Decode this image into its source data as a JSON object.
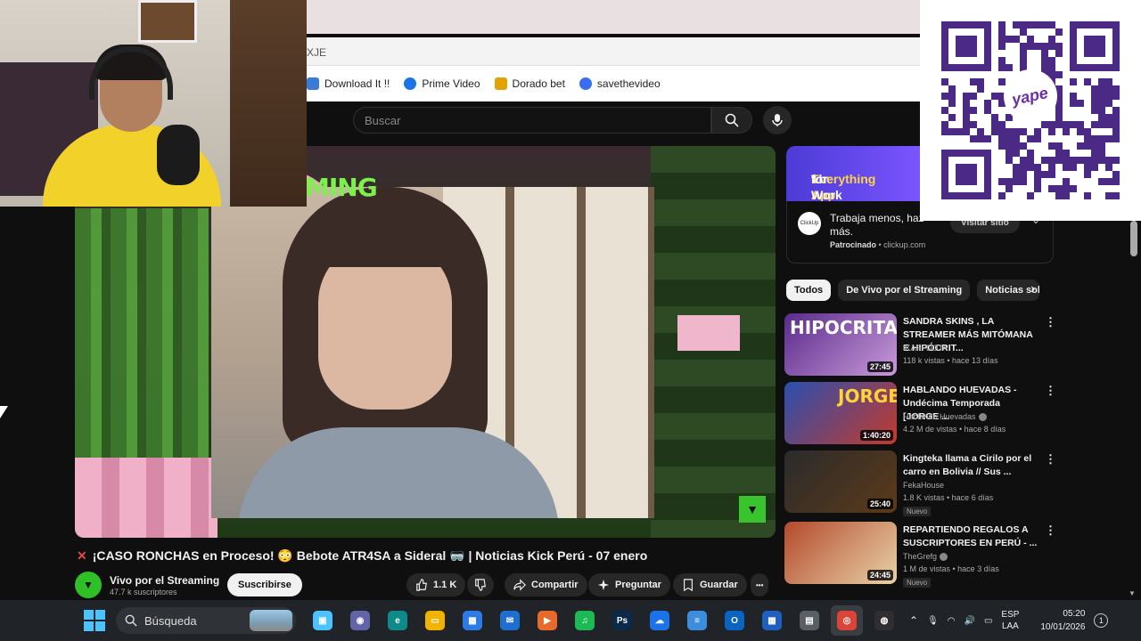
{
  "browser": {
    "url_fragment": "XJE",
    "bookmarks": [
      {
        "label": "Download It !!",
        "color": "#3b7bd6"
      },
      {
        "label": "Prime Video",
        "color": "#1a73e8"
      },
      {
        "label": "Dorado bet",
        "color": "#e2a200"
      },
      {
        "label": "savethevideo",
        "color": "#3a6df0"
      }
    ]
  },
  "youtube": {
    "search_placeholder": "Buscar",
    "video": {
      "overlay_text": "MING",
      "title_mark": "✕",
      "title": "¡CASO RONCHAS en Proceso! 😳 Bebote ATR4SA a Sideral 🥽 | Noticias Kick Perú - 07 enero",
      "channel_name": "Vivo por el Streaming",
      "channel_subs": "47.7 k suscriptores",
      "subscribe_label": "Suscribirse",
      "like_count": "1.1 K",
      "share_label": "Compartir",
      "ask_label": "Preguntar",
      "save_label": "Guardar",
      "more_label": "•••"
    },
    "ad": {
      "banner_line1_prefix": "The",
      "banner_line1_highlight": "Everything App",
      "banner_line2": "for Work",
      "logo_label": "ClickUp",
      "text": "Trabaja menos, haz más.",
      "sponsored_label": "Patrocinado",
      "domain": "clickup.com",
      "visit_label": "Visitar sitio"
    },
    "chips": [
      "Todos",
      "De Vivo por el Streaming",
      "Noticias sob"
    ],
    "recommendations": [
      {
        "thumb_text": "HIPOCRITA",
        "duration": "27:45",
        "title": "SANDRA SKINS , LA STREAMER MÁS MITÓMANA E HIPÓCRIT...",
        "channel": "IKARI DOTA",
        "meta": "118 k vistas • hace 13 días",
        "badge": "",
        "thumb_color": "#5a2b8c"
      },
      {
        "thumb_text": "JORGE",
        "duration": "1:40:20",
        "title": "HABLANDO HUEVADAS - Undécima Temporada [JORGE ...",
        "channel": "Hablando Huevadas",
        "meta": "4.2 M de vistas • hace 8 días",
        "badge": "",
        "thumb_color": "#2a4fb0"
      },
      {
        "thumb_text": "",
        "duration": "25:40",
        "title": "Kingteka llama a Cirilo por el carro en Bolivia // Sus ...",
        "channel": "FekaHouse",
        "meta": "1.8 K vistas • hace 6 días",
        "badge": "Nuevo",
        "thumb_color": "#3a3a3a"
      },
      {
        "thumb_text": "",
        "duration": "24:45",
        "title": "REPARTIENDO REGALOS A SUSCRIPTORES EN PERÚ - ...",
        "channel": "TheGrefg",
        "meta": "1 M de vistas • hace 3 días",
        "badge": "Nuevo",
        "thumb_color": "#9a3a2c"
      }
    ]
  },
  "qr": {
    "brand": "yape"
  },
  "taskbar": {
    "search_label": "Búsqueda",
    "lang_line1": "ESP",
    "lang_line2": "LAA",
    "time": "05:20",
    "date": "10/01/2026",
    "notif_count": "1",
    "apps": [
      {
        "name": "task-view",
        "color": "#4cc2ff",
        "glyph": "▣"
      },
      {
        "name": "teams",
        "color": "#6264a7",
        "glyph": "◉"
      },
      {
        "name": "edge",
        "color": "#0f8a8a",
        "glyph": "e"
      },
      {
        "name": "file-explorer",
        "color": "#f2b300",
        "glyph": "▭"
      },
      {
        "name": "store",
        "color": "#2c7be5",
        "glyph": "▦"
      },
      {
        "name": "mail",
        "color": "#1f6fd1",
        "glyph": "✉"
      },
      {
        "name": "media-player",
        "color": "#e86a2a",
        "glyph": "▶"
      },
      {
        "name": "spotify",
        "color": "#1db954",
        "glyph": "♫"
      },
      {
        "name": "photoshop",
        "color": "#0b2a4a",
        "glyph": "Ps"
      },
      {
        "name": "onedrive",
        "color": "#1a73e8",
        "glyph": "☁"
      },
      {
        "name": "notepad",
        "color": "#3c8dde",
        "glyph": "≡"
      },
      {
        "name": "outlook",
        "color": "#0a64c2",
        "glyph": "O"
      },
      {
        "name": "calendar",
        "color": "#1f5fbf",
        "glyph": "▦"
      },
      {
        "name": "calculator",
        "color": "#5a5f66",
        "glyph": "▤"
      },
      {
        "name": "chrome",
        "color": "#db4437",
        "glyph": "◎"
      },
      {
        "name": "obs",
        "color": "#302e31",
        "glyph": "◍"
      }
    ]
  }
}
